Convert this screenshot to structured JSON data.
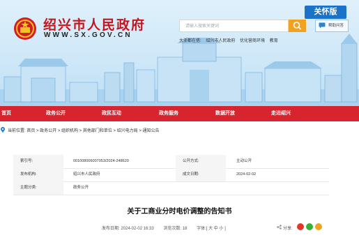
{
  "header": {
    "site_title": "绍兴市人民政府",
    "site_url": "WWW.SX.GOV.CN",
    "care_mode_label": "关怀版",
    "search_placeholder": "请输入搜索关键词",
    "help_label": "帮助问答",
    "region_label": "大浙都在搭:",
    "region_links": [
      "绍兴市人民政府",
      "优化营商环境",
      "教育"
    ]
  },
  "nav": {
    "items": [
      "首页",
      "政务公开",
      "政民互动",
      "政务服务",
      "数据开放",
      "走进绍兴"
    ]
  },
  "breadcrumb": {
    "text": "当前位置: 首页 > 政务公开 > 组织机构 > 其他部门和单位 > 绍兴电力局 > 通知公告"
  },
  "meta": {
    "rows": [
      {
        "label1": "索引号:",
        "value1": "001008006007053/2024-248620",
        "label2": "公开方式:",
        "value2": "主动公开"
      },
      {
        "label1": "发布机构:",
        "value1": "绍兴市人民政府",
        "label2": "成文日期:",
        "value2": "2024-02-02"
      },
      {
        "label1": "主题分类:",
        "value1": "政务公开",
        "label2": "",
        "value2": ""
      }
    ]
  },
  "document": {
    "title": "关于工商业分时电价调整的告知书",
    "publish_date": "发布日期: 2024-02-02 16:33",
    "views": "浏览次数: 18",
    "font_size": "字体:[ 大 中 小 ]",
    "share_label": "分享:"
  },
  "colors": {
    "nav_red": "#d8242f",
    "brand_red": "#c4151c",
    "accent_blue": "#1a73c8",
    "search_orange": "#f0a320"
  },
  "icons": {
    "emblem": "national-emblem-icon",
    "search": "search-icon",
    "help": "help-chat-icon",
    "location": "location-pin-icon",
    "share": [
      "weibo-icon",
      "wechat-icon",
      "qq-icon"
    ]
  }
}
